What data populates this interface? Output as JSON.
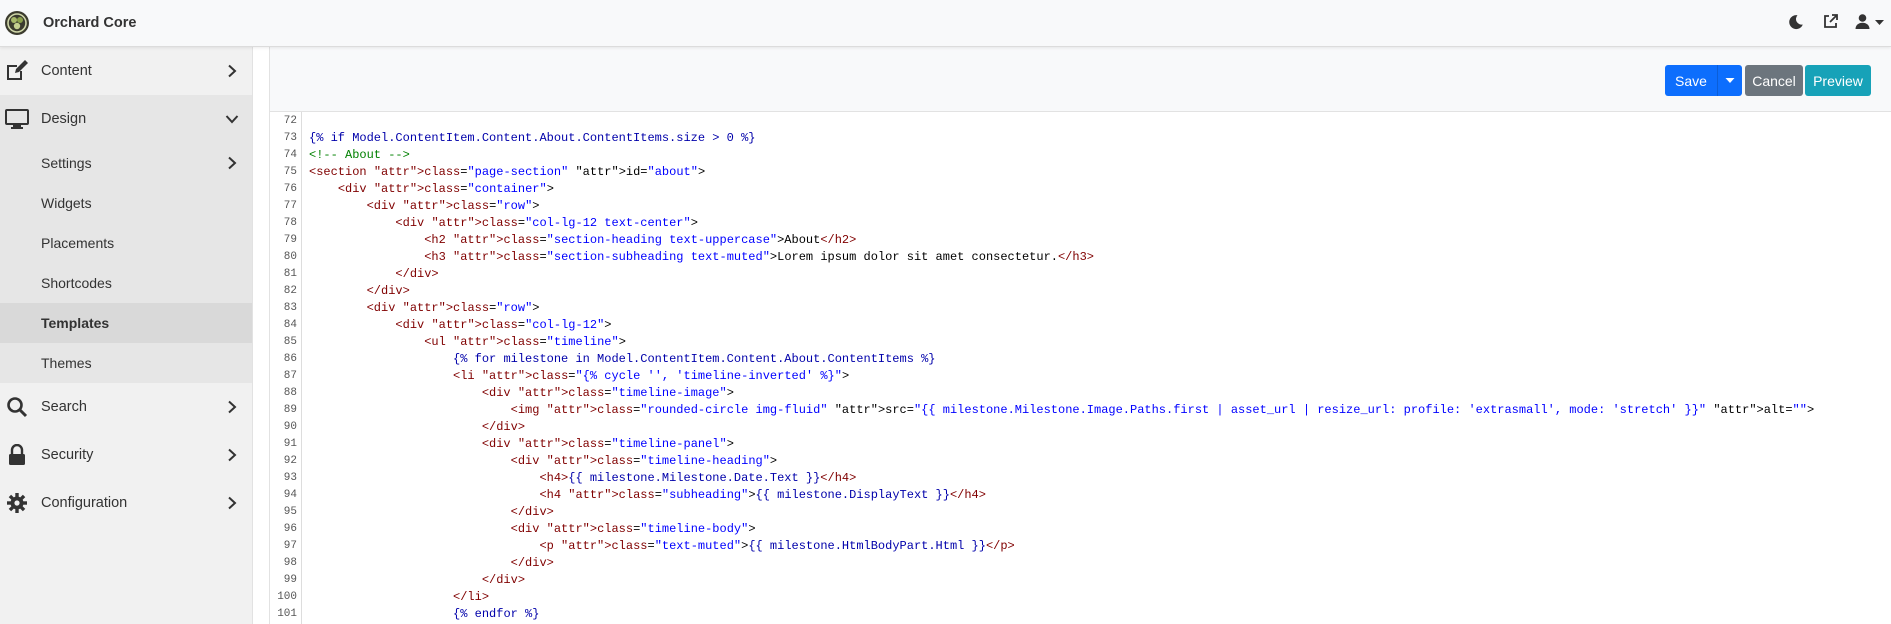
{
  "app": {
    "brand": "Orchard Core"
  },
  "topbar": {
    "icons": [
      "moon-icon",
      "external-link-icon",
      "user-icon",
      "caret-down-icon"
    ]
  },
  "sidebar": {
    "items": [
      {
        "label": "Content",
        "icon": "edit-icon",
        "expanded": false
      },
      {
        "label": "Design",
        "icon": "monitor-icon",
        "expanded": true,
        "children": [
          {
            "label": "Settings",
            "has_submenu": true
          },
          {
            "label": "Widgets"
          },
          {
            "label": "Placements"
          },
          {
            "label": "Shortcodes"
          },
          {
            "label": "Templates",
            "active": true
          },
          {
            "label": "Themes"
          }
        ]
      },
      {
        "label": "Search",
        "icon": "search-icon",
        "expanded": false
      },
      {
        "label": "Security",
        "icon": "lock-icon",
        "expanded": false
      },
      {
        "label": "Configuration",
        "icon": "gear-icon",
        "expanded": false
      }
    ]
  },
  "toolbar": {
    "save_label": "Save",
    "cancel_label": "Cancel",
    "preview_label": "Preview"
  },
  "colors": {
    "primary": "#0d6efd",
    "secondary": "#6c757d",
    "info": "#17a2b8"
  },
  "editor": {
    "lines": [
      {
        "n": "72",
        "t": ""
      },
      {
        "n": "73",
        "t": "{% if Model.ContentItem.Content.About.ContentItems.size > 0 %}"
      },
      {
        "n": "74",
        "t": "<!-- About -->"
      },
      {
        "n": "75",
        "t": "<section class=\"page-section\" id=\"about\">"
      },
      {
        "n": "76",
        "t": "    <div class=\"container\">"
      },
      {
        "n": "77",
        "t": "        <div class=\"row\">"
      },
      {
        "n": "78",
        "t": "            <div class=\"col-lg-12 text-center\">"
      },
      {
        "n": "79",
        "t": "                <h2 class=\"section-heading text-uppercase\">About</h2>"
      },
      {
        "n": "80",
        "t": "                <h3 class=\"section-subheading text-muted\">Lorem ipsum dolor sit amet consectetur.</h3>"
      },
      {
        "n": "81",
        "t": "            </div>"
      },
      {
        "n": "82",
        "t": "        </div>"
      },
      {
        "n": "83",
        "t": "        <div class=\"row\">"
      },
      {
        "n": "84",
        "t": "            <div class=\"col-lg-12\">"
      },
      {
        "n": "85",
        "t": "                <ul class=\"timeline\">"
      },
      {
        "n": "86",
        "t": "                    {% for milestone in Model.ContentItem.Content.About.ContentItems %}"
      },
      {
        "n": "87",
        "t": "                    <li class=\"{% cycle '', 'timeline-inverted' %}\">"
      },
      {
        "n": "88",
        "t": "                        <div class=\"timeline-image\">"
      },
      {
        "n": "89",
        "t": "                            <img class=\"rounded-circle img-fluid\" src=\"{{ milestone.Milestone.Image.Paths.first | asset_url | resize_url: profile: 'extrasmall', mode: 'stretch' }}\" alt=\"\">"
      },
      {
        "n": "90",
        "t": "                        </div>"
      },
      {
        "n": "91",
        "t": "                        <div class=\"timeline-panel\">"
      },
      {
        "n": "92",
        "t": "                            <div class=\"timeline-heading\">"
      },
      {
        "n": "93",
        "t": "                                <h4>{{ milestone.Milestone.Date.Text }}</h4>"
      },
      {
        "n": "94",
        "t": "                                <h4 class=\"subheading\">{{ milestone.DisplayText }}</h4>"
      },
      {
        "n": "95",
        "t": "                            </div>"
      },
      {
        "n": "96",
        "t": "                            <div class=\"timeline-body\">"
      },
      {
        "n": "97",
        "t": "                                <p class=\"text-muted\">{{ milestone.HtmlBodyPart.Html }}</p>"
      },
      {
        "n": "98",
        "t": "                            </div>"
      },
      {
        "n": "99",
        "t": "                        </div>"
      },
      {
        "n": "100",
        "t": "                    </li>"
      },
      {
        "n": "101",
        "t": "                    {% endfor %}"
      }
    ]
  }
}
